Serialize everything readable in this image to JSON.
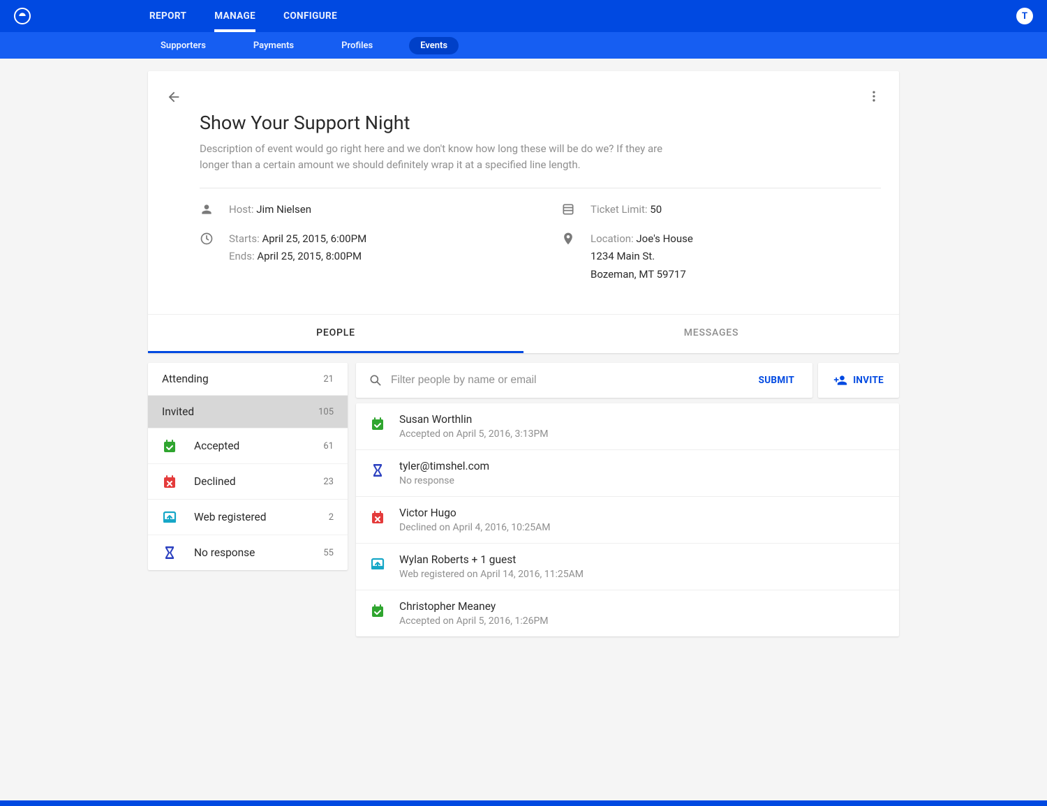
{
  "colors": {
    "primary": "#0049e1",
    "green": "#2fa52f",
    "red": "#e43b3b",
    "cyan": "#17a7c7",
    "indigo": "#2a3fbf"
  },
  "avatarLetter": "T",
  "topnav": [
    {
      "label": "REPORT",
      "active": false
    },
    {
      "label": "MANAGE",
      "active": true
    },
    {
      "label": "CONFIGURE",
      "active": false
    }
  ],
  "subnav": [
    {
      "label": "Supporters",
      "active": false
    },
    {
      "label": "Payments",
      "active": false
    },
    {
      "label": "Profiles",
      "active": false
    },
    {
      "label": "Events",
      "active": true
    }
  ],
  "event": {
    "title": "Show Your Support Night",
    "description": "Description of event would go right here and we don't know how long these will be do we? If they are longer than a certain amount we should definitely wrap it at a specified line length.",
    "hostLabel": "Host:",
    "hostValue": "Jim Nielsen",
    "startsLabel": "Starts:",
    "startsValue": "April 25, 2015, 6:00PM",
    "endsLabel": "Ends:",
    "endsValue": "April 25, 2015, 8:00PM",
    "ticketLabel": "Ticket Limit:",
    "ticketValue": "50",
    "locationLabel": "Location:",
    "locationName": "Joe's House",
    "locationLine1": "1234 Main St.",
    "locationLine2": "Bozeman, MT 59717"
  },
  "tabs": [
    {
      "label": "PEOPLE",
      "active": true
    },
    {
      "label": "MESSAGES",
      "active": false
    }
  ],
  "sidebar": {
    "top": [
      {
        "label": "Attending",
        "count": "21",
        "selected": false
      },
      {
        "label": "Invited",
        "count": "105",
        "selected": true
      }
    ],
    "statuses": [
      {
        "label": "Accepted",
        "count": "61",
        "icon": "accepted"
      },
      {
        "label": "Declined",
        "count": "23",
        "icon": "declined"
      },
      {
        "label": "Web registered",
        "count": "2",
        "icon": "web"
      },
      {
        "label": "No response",
        "count": "55",
        "icon": "noresponse"
      }
    ]
  },
  "filter": {
    "placeholder": "Filter people by name or email",
    "submitLabel": "SUBMIT",
    "inviteLabel": "INVITE"
  },
  "people": [
    {
      "name": "Susan Worthlin",
      "status": "Accepted on April 5, 2016, 3:13PM",
      "icon": "accepted"
    },
    {
      "name": "tyler@timshel.com",
      "status": "No response",
      "icon": "noresponse"
    },
    {
      "name": "Victor Hugo",
      "status": "Declined on April 4, 2016, 10:25AM",
      "icon": "declined"
    },
    {
      "name": "Wylan Roberts + 1 guest",
      "status": "Web registered on April 14, 2016, 11:25AM",
      "icon": "web"
    },
    {
      "name": "Christopher Meaney",
      "status": "Accepted on April 5, 2016, 1:26PM",
      "icon": "accepted"
    }
  ]
}
